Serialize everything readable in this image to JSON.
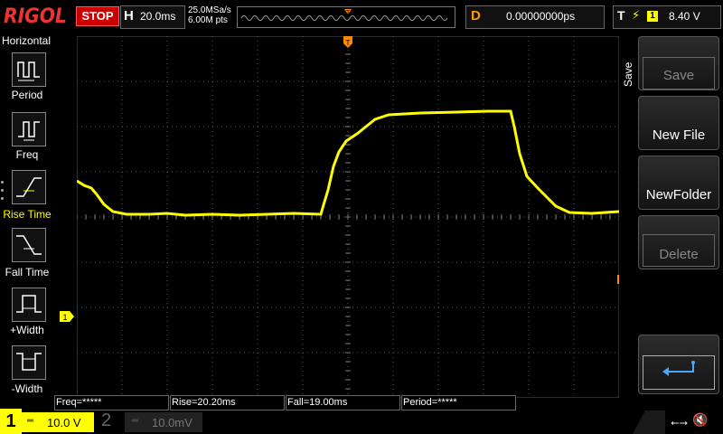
{
  "brand": "RIGOL",
  "run_state": "STOP",
  "horizontal": {
    "label": "H",
    "timebase": "20.0ms"
  },
  "sampling": {
    "rate": "25.0MSa/s",
    "points": "6.00M pts"
  },
  "delay": {
    "label": "D",
    "value": "0.00000000ps"
  },
  "trigger": {
    "label": "T",
    "slope_icon": "rising-edge-icon",
    "source": "1",
    "level": "8.40 V"
  },
  "left_menu": {
    "title": "Horizontal",
    "items": [
      {
        "label": "Period",
        "icon": "period-icon",
        "active": false
      },
      {
        "label": "Freq",
        "icon": "freq-icon",
        "active": false
      },
      {
        "label": "Rise Time",
        "icon": "rise-time-icon",
        "active": true
      },
      {
        "label": "Fall Time",
        "icon": "fall-time-icon",
        "active": false
      },
      {
        "label": "+Width",
        "icon": "positive-width-icon",
        "active": false
      },
      {
        "label": "-Width",
        "icon": "negative-width-icon",
        "active": false
      }
    ]
  },
  "markers": {
    "trigger_pos": "T",
    "channel1": "1"
  },
  "right_menu": {
    "title": "Save",
    "buttons": [
      {
        "label": "Save",
        "enabled": false
      },
      {
        "label": "New File",
        "enabled": true
      },
      {
        "label": "NewFolder",
        "enabled": true
      },
      {
        "label": "Delete",
        "enabled": false
      },
      {
        "label": "",
        "icon": "return-arrow-icon",
        "enabled": true
      }
    ]
  },
  "measurements": [
    {
      "text": "Freq=*****"
    },
    {
      "text": "Rise=20.20ms"
    },
    {
      "text": "Fall=19.00ms"
    },
    {
      "text": "Period=*****"
    }
  ],
  "channels": [
    {
      "num": "1",
      "scale": "10.0 V",
      "color": "#ffff00",
      "active": true
    },
    {
      "num": "2",
      "scale": "10.0mV",
      "color": "#00ffff",
      "active": false
    }
  ],
  "status_icons": [
    "usb-icon",
    "speaker-mute-icon"
  ],
  "colors": {
    "trace": "#ffff00",
    "grid": "#555555",
    "accent": "#ff8800",
    "stop": "#cc0000"
  }
}
